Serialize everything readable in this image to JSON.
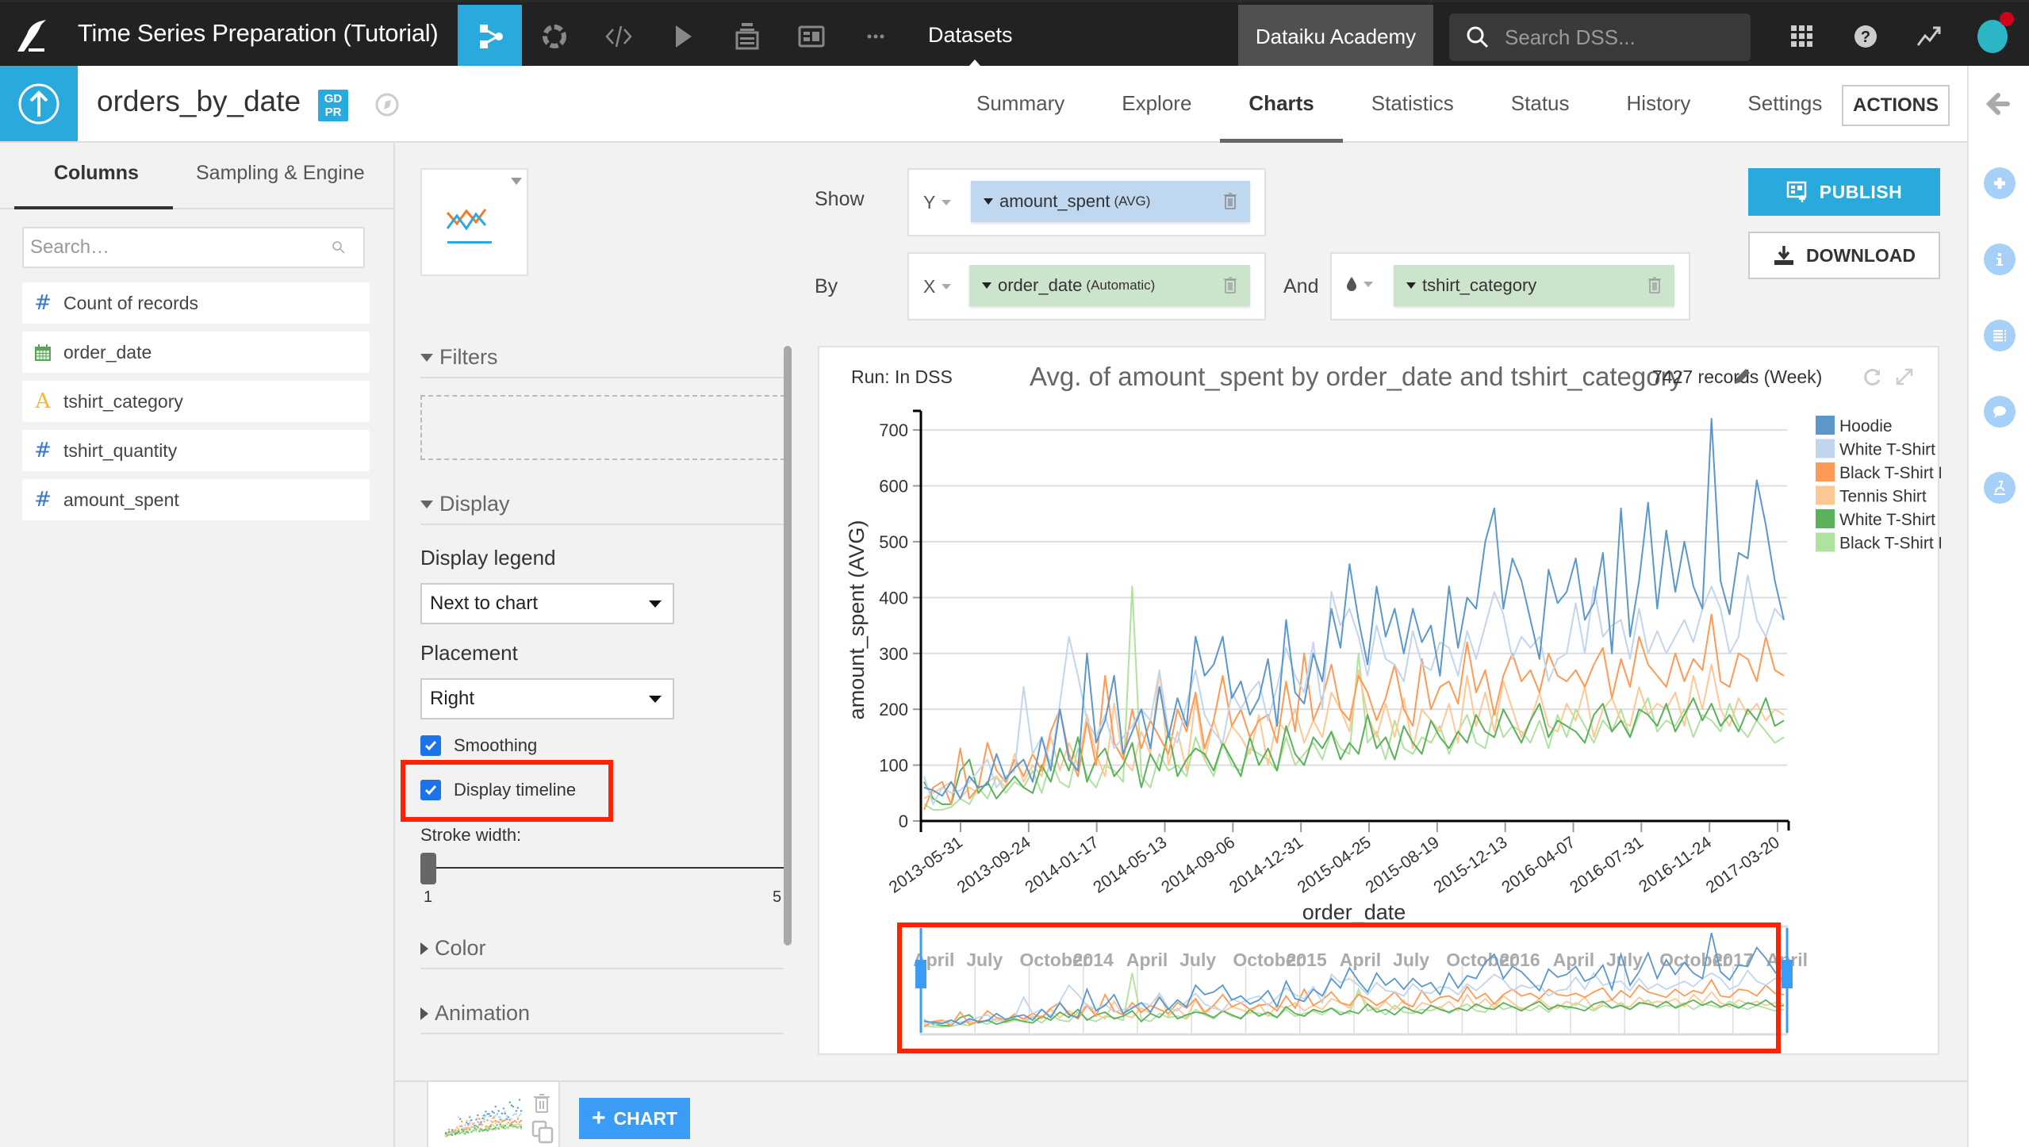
{
  "topbar": {
    "project_title": "Time Series Preparation (Tutorial)",
    "nav_icons": [
      "flow-icon",
      "recipes-icon",
      "code-icon",
      "run-icon",
      "datasets-stack-icon",
      "dashboard-icon",
      "more-icon"
    ],
    "current_section": "Datasets",
    "academy_label": "Dataiku Academy",
    "search_placeholder": "Search DSS..."
  },
  "dataset": {
    "name": "orders_by_date",
    "badge_line1": "GD",
    "badge_line2": "PR"
  },
  "tabs": [
    {
      "label": "Summary",
      "active": false
    },
    {
      "label": "Explore",
      "active": false
    },
    {
      "label": "Charts",
      "active": true
    },
    {
      "label": "Statistics",
      "active": false
    },
    {
      "label": "Status",
      "active": false
    },
    {
      "label": "History",
      "active": false
    },
    {
      "label": "Settings",
      "active": false
    }
  ],
  "actions_label": "ACTIONS",
  "left_panel": {
    "tabs": [
      "Columns",
      "Sampling & Engine"
    ],
    "active_tab": "Columns",
    "search_placeholder": "Search…",
    "columns": [
      {
        "label": "Count of records",
        "type": "numeric",
        "icon": "#"
      },
      {
        "label": "order_date",
        "type": "date",
        "icon": "calendar"
      },
      {
        "label": "tshirt_category",
        "type": "text",
        "icon": "A"
      },
      {
        "label": "tshirt_quantity",
        "type": "numeric",
        "icon": "#"
      },
      {
        "label": "amount_spent",
        "type": "numeric",
        "icon": "#"
      }
    ]
  },
  "options": {
    "filters_label": "Filters",
    "display_label": "Display",
    "display_legend_label": "Display legend",
    "display_legend_value": "Next to chart",
    "placement_label": "Placement",
    "placement_value": "Right",
    "smoothing_label": "Smoothing",
    "smoothing_checked": true,
    "timeline_label": "Display timeline",
    "timeline_checked": true,
    "stroke_label": "Stroke width:",
    "stroke_min": "1",
    "stroke_max": "5",
    "stroke_value": 1,
    "color_label": "Color",
    "animation_label": "Animation"
  },
  "config": {
    "show_label": "Show",
    "by_label": "By",
    "and_label": "And",
    "y_axis": "Y",
    "x_axis": "X",
    "y_field": "amount_spent",
    "y_agg": "(AVG)",
    "x_field": "order_date",
    "x_mode": "(Automatic)",
    "color_field": "tshirt_category",
    "colors": {
      "measure_pill": "#bfd8ef",
      "dimension_pill": "#cde4cc"
    }
  },
  "buttons": {
    "publish": "PUBLISH",
    "download": "DOWNLOAD",
    "add_chart": "CHART"
  },
  "chart_header": {
    "run_label": "Run: In DSS",
    "records_label": "7427 records (Week)"
  },
  "chart_data": {
    "type": "line",
    "title": "Avg. of amount_spent by order_date and tshirt_category",
    "xlabel": "order_date",
    "ylabel": "amount_spent (AVG)",
    "ylim": [
      0,
      720
    ],
    "yticks": [
      0,
      100,
      200,
      300,
      400,
      500,
      600,
      700
    ],
    "xticks": [
      "2013-05-31",
      "2013-09-24",
      "2014-01-17",
      "2014-05-13",
      "2014-09-06",
      "2014-12-31",
      "2015-04-25",
      "2015-08-19",
      "2015-12-13",
      "2016-04-07",
      "2016-07-31",
      "2016-11-24",
      "2017-03-20"
    ],
    "x_granularity": "week",
    "grid": true,
    "legend_position": "right",
    "smoothing": true,
    "timeline_labels": [
      "April",
      "July",
      "October",
      "2014",
      "April",
      "July",
      "October",
      "2015",
      "April",
      "July",
      "October",
      "2016",
      "April",
      "July",
      "October",
      "2017",
      "April"
    ],
    "series": [
      {
        "name": "Hoodie",
        "color": "#5b98c9",
        "values": [
          60,
          55,
          45,
          70,
          40,
          80,
          60,
          65,
          120,
          75,
          95,
          110,
          70,
          150,
          90,
          200,
          110,
          90,
          300,
          140,
          180,
          260,
          120,
          160,
          200,
          130,
          240,
          150,
          220,
          170,
          330,
          260,
          280,
          330,
          220,
          250,
          190,
          220,
          290,
          170,
          360,
          230,
          210,
          300,
          250,
          380,
          310,
          460,
          360,
          280,
          420,
          330,
          380,
          300,
          380,
          320,
          350,
          260,
          420,
          310,
          400,
          380,
          500,
          560,
          380,
          470,
          430,
          360,
          290,
          450,
          390,
          410,
          470,
          360,
          390,
          480,
          300,
          560,
          330,
          430,
          570,
          380,
          520,
          410,
          500,
          420,
          380,
          720,
          430,
          370,
          480,
          470,
          610,
          530,
          430,
          360
        ]
      },
      {
        "name": "White T-Shirt M",
        "color": "#c2d5ee",
        "values": [
          80,
          30,
          60,
          50,
          55,
          70,
          90,
          110,
          60,
          80,
          90,
          240,
          120,
          150,
          100,
          210,
          330,
          260,
          180,
          150,
          190,
          130,
          150,
          170,
          200,
          180,
          270,
          160,
          140,
          210,
          270,
          190,
          160,
          140,
          230,
          200,
          230,
          250,
          180,
          240,
          310,
          260,
          230,
          320,
          200,
          410,
          350,
          380,
          330,
          260,
          350,
          290,
          280,
          250,
          340,
          280,
          270,
          320,
          310,
          260,
          340,
          290,
          350,
          410,
          370,
          290,
          330,
          310,
          330,
          250,
          290,
          300,
          390,
          300,
          420,
          330,
          350,
          360,
          290,
          380,
          300,
          340,
          300,
          330,
          360,
          320,
          380,
          420,
          380,
          300,
          330,
          440,
          360,
          330,
          380,
          360
        ]
      },
      {
        "name": "Black T-Shirt M",
        "color": "#fd9a55",
        "values": [
          20,
          60,
          70,
          30,
          130,
          40,
          60,
          140,
          90,
          70,
          110,
          80,
          120,
          90,
          160,
          200,
          120,
          80,
          180,
          100,
          260,
          140,
          110,
          200,
          130,
          180,
          150,
          120,
          200,
          160,
          230,
          130,
          180,
          260,
          170,
          200,
          150,
          180,
          190,
          140,
          250,
          160,
          300,
          180,
          220,
          280,
          200,
          180,
          260,
          230,
          180,
          220,
          280,
          200,
          170,
          290,
          200,
          240,
          250,
          210,
          320,
          230,
          270,
          190,
          260,
          300,
          250,
          270,
          230,
          300,
          260,
          250,
          270,
          240,
          280,
          310,
          220,
          290,
          240,
          330,
          280,
          260,
          240,
          300,
          250,
          290,
          270,
          370,
          250,
          240,
          300,
          290,
          250,
          330,
          270,
          260
        ]
      },
      {
        "name": "Tennis Shirt",
        "color": "#fec894",
        "values": [
          40,
          50,
          60,
          70,
          40,
          60,
          50,
          70,
          80,
          60,
          120,
          70,
          100,
          80,
          150,
          90,
          140,
          100,
          190,
          120,
          80,
          210,
          110,
          90,
          160,
          120,
          270,
          100,
          160,
          90,
          220,
          110,
          180,
          130,
          170,
          150,
          120,
          190,
          100,
          180,
          160,
          200,
          140,
          180,
          150,
          230,
          200,
          160,
          270,
          190,
          150,
          210,
          150,
          220,
          130,
          200,
          180,
          160,
          210,
          140,
          260,
          170,
          230,
          160,
          250,
          200,
          150,
          180,
          230,
          170,
          160,
          210,
          180,
          240,
          150,
          200,
          220,
          180,
          170,
          240,
          190,
          210,
          200,
          230,
          170,
          260,
          200,
          280,
          200,
          170,
          220,
          190,
          210,
          180,
          200,
          190
        ]
      },
      {
        "name": "White T-Shirt F",
        "color": "#5bb05a",
        "values": [
          70,
          40,
          30,
          30,
          90,
          110,
          50,
          70,
          40,
          60,
          80,
          60,
          50,
          100,
          70,
          130,
          90,
          150,
          70,
          110,
          130,
          80,
          100,
          140,
          60,
          120,
          90,
          160,
          80,
          110,
          130,
          120,
          90,
          140,
          110,
          80,
          150,
          100,
          130,
          90,
          170,
          120,
          100,
          150,
          130,
          160,
          110,
          140,
          120,
          190,
          130,
          150,
          110,
          170,
          140,
          120,
          180,
          150,
          130,
          160,
          140,
          190,
          160,
          150,
          200,
          170,
          140,
          180,
          210,
          150,
          180,
          170,
          160,
          140,
          190,
          210,
          160,
          180,
          150,
          200,
          190,
          170,
          210,
          160,
          190,
          220,
          180,
          210,
          170,
          190,
          160,
          200,
          180,
          220,
          170,
          180
        ]
      },
      {
        "name": "Black T-Shirt F",
        "color": "#b0e29f",
        "values": [
          30,
          20,
          20,
          25,
          40,
          30,
          60,
          40,
          80,
          50,
          70,
          60,
          90,
          50,
          110,
          70,
          60,
          130,
          80,
          60,
          100,
          90,
          70,
          420,
          80,
          60,
          120,
          90,
          100,
          80,
          150,
          110,
          80,
          140,
          100,
          90,
          130,
          120,
          110,
          90,
          150,
          100,
          120,
          140,
          110,
          160,
          130,
          120,
          300,
          140,
          160,
          110,
          180,
          130,
          120,
          150,
          140,
          170,
          120,
          160,
          190,
          140,
          130,
          200,
          150,
          170,
          160,
          140,
          180,
          130,
          190,
          150,
          200,
          170,
          140,
          180,
          160,
          200,
          150,
          190,
          220,
          160,
          180,
          170,
          200,
          150,
          190,
          180,
          160,
          210,
          170,
          150,
          180,
          160,
          140,
          150
        ]
      }
    ]
  }
}
